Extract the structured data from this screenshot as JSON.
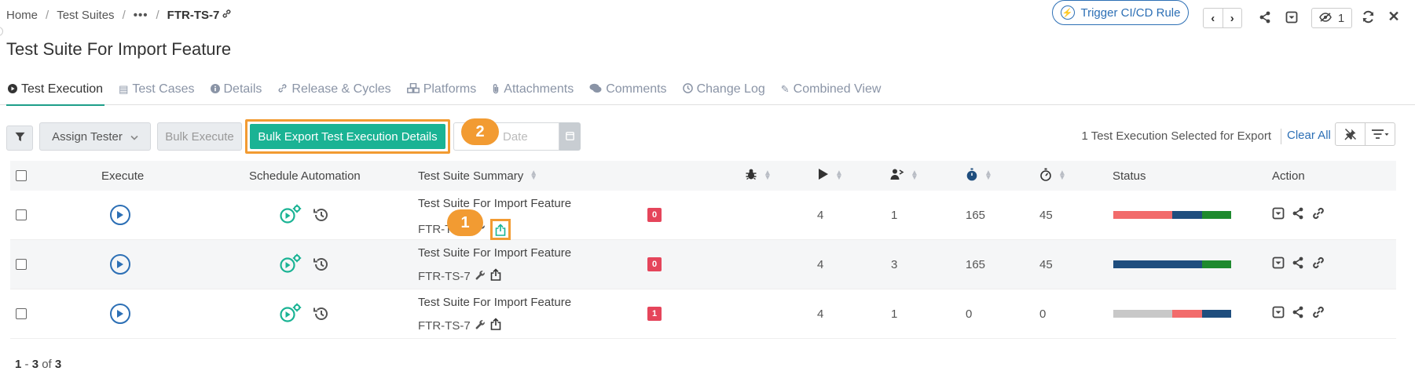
{
  "breadcrumb": {
    "home": "Home",
    "test_suites": "Test Suites",
    "more": "•••",
    "current": "FTR-TS-7"
  },
  "header": {
    "trigger_label": "Trigger CI/CD Rule",
    "watch_count": "1"
  },
  "page_title": "Test Suite For Import Feature",
  "tabs": [
    {
      "label": "Test Execution",
      "icon": "play-circle-icon"
    },
    {
      "label": "Test Cases",
      "icon": "file-icon"
    },
    {
      "label": "Details",
      "icon": "info-icon"
    },
    {
      "label": "Release & Cycles",
      "icon": "link-icon"
    },
    {
      "label": "Platforms",
      "icon": "cubes-icon"
    },
    {
      "label": "Attachments",
      "icon": "paperclip-icon"
    },
    {
      "label": "Comments",
      "icon": "comments-icon"
    },
    {
      "label": "Change Log",
      "icon": "clock-icon"
    },
    {
      "label": "Combined View",
      "icon": "pencil-icon"
    }
  ],
  "toolbar": {
    "assign_tester": "Assign Tester",
    "bulk_execute": "Bulk Execute",
    "bulk_export": "Bulk Export Test Execution Details",
    "date_placeholder": "Date",
    "selected_text": "1 Test Execution Selected for Export",
    "clear_all": "Clear All"
  },
  "callouts": {
    "one": "1",
    "two": "2"
  },
  "table": {
    "headers": {
      "execute": "Execute",
      "schedule": "Schedule Automation",
      "summary": "Test Suite Summary",
      "status": "Status",
      "action": "Action"
    },
    "rows": [
      {
        "title": "Test Suite For Import Feature",
        "key": "FTR-TS-7",
        "defects": "0",
        "total": "4",
        "assigned": "1",
        "estimated": "165",
        "actual": "45",
        "status": [
          {
            "color": "#f26b6b",
            "pct": 50
          },
          {
            "color": "#1f4e7e",
            "pct": 25
          },
          {
            "color": "#1e8a2e",
            "pct": 25
          }
        ]
      },
      {
        "title": "Test Suite For Import Feature",
        "key": "FTR-TS-7",
        "defects": "0",
        "total": "4",
        "assigned": "3",
        "estimated": "165",
        "actual": "45",
        "status": [
          {
            "color": "#1f4e7e",
            "pct": 75
          },
          {
            "color": "#1e8a2e",
            "pct": 25
          }
        ]
      },
      {
        "title": "Test Suite For Import Feature",
        "key": "FTR-TS-7",
        "defects": "1",
        "total": "4",
        "assigned": "1",
        "estimated": "0",
        "actual": "0",
        "status": [
          {
            "color": "#c8c8c8",
            "pct": 50
          },
          {
            "color": "#f26b6b",
            "pct": 25
          },
          {
            "color": "#1f4e7e",
            "pct": 25
          }
        ]
      }
    ]
  },
  "pagination": {
    "start": "1",
    "dash": " - ",
    "end": "3",
    "of": " of ",
    "total": "3"
  },
  "colors": {
    "accent": "#1ab394",
    "highlight": "#f29b32",
    "link": "#2c6fb5",
    "danger": "#e5455b"
  }
}
